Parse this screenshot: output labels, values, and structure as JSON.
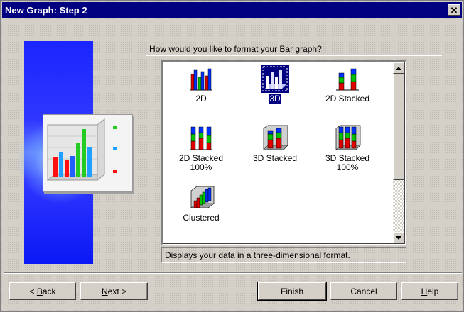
{
  "window": {
    "title": "New Graph: Step 2",
    "close_glyph": "✕"
  },
  "prompt": "How would you like to format your Bar graph?",
  "options": [
    {
      "label": "2D",
      "icon": "bar-2d-icon",
      "selected": false
    },
    {
      "label": "3D",
      "icon": "bar-3d-icon",
      "selected": true
    },
    {
      "label": "2D Stacked",
      "icon": "stacked-2d-icon",
      "selected": false
    },
    {
      "label": "2D Stacked 100%",
      "icon": "stacked-2d-100-icon",
      "selected": false
    },
    {
      "label": "3D Stacked",
      "icon": "stacked-3d-icon",
      "selected": false
    },
    {
      "label": "3D Stacked 100%",
      "icon": "stacked-3d-100-icon",
      "selected": false
    },
    {
      "label": "Clustered",
      "icon": "clustered-icon",
      "selected": false
    }
  ],
  "status_text": "Displays your data in a three-dimensional format.",
  "buttons": {
    "back_prefix": "< ",
    "back_key": "B",
    "back_rest": "ack",
    "next_key": "N",
    "next_rest": "ext >",
    "finish": "Finish",
    "cancel": "Cancel",
    "help_key": "H",
    "help_rest": "elp"
  },
  "colors": {
    "title_bar": "#000080",
    "selection": "#000080",
    "bar_red": "#e00000",
    "bar_green": "#00c000",
    "bar_blue": "#0030ff",
    "art_blue": "#1a26ff"
  }
}
